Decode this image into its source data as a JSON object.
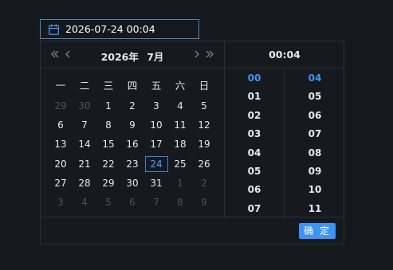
{
  "input": {
    "value": "2026-07-24 00:04",
    "icon": "calendar-icon"
  },
  "calendar": {
    "year_label": "2026年",
    "month_label": "7月",
    "weekdays": [
      "一",
      "二",
      "三",
      "四",
      "五",
      "六",
      "日"
    ],
    "days": [
      {
        "label": "29",
        "muted": true
      },
      {
        "label": "30",
        "muted": true
      },
      {
        "label": "1"
      },
      {
        "label": "2"
      },
      {
        "label": "3"
      },
      {
        "label": "4"
      },
      {
        "label": "5"
      },
      {
        "label": "6"
      },
      {
        "label": "7"
      },
      {
        "label": "8"
      },
      {
        "label": "9"
      },
      {
        "label": "10"
      },
      {
        "label": "11"
      },
      {
        "label": "12"
      },
      {
        "label": "13"
      },
      {
        "label": "14"
      },
      {
        "label": "15"
      },
      {
        "label": "16"
      },
      {
        "label": "17"
      },
      {
        "label": "18"
      },
      {
        "label": "19"
      },
      {
        "label": "20"
      },
      {
        "label": "21"
      },
      {
        "label": "22"
      },
      {
        "label": "23"
      },
      {
        "label": "24",
        "selected": true
      },
      {
        "label": "25"
      },
      {
        "label": "26"
      },
      {
        "label": "27"
      },
      {
        "label": "28"
      },
      {
        "label": "29"
      },
      {
        "label": "30"
      },
      {
        "label": "31"
      },
      {
        "label": "1",
        "muted": true
      },
      {
        "label": "2",
        "muted": true
      },
      {
        "label": "3",
        "muted": true
      },
      {
        "label": "4",
        "muted": true
      },
      {
        "label": "5",
        "muted": true
      },
      {
        "label": "6",
        "muted": true
      },
      {
        "label": "7",
        "muted": true
      },
      {
        "label": "8",
        "muted": true
      },
      {
        "label": "9",
        "muted": true
      }
    ]
  },
  "time": {
    "header": "00:04",
    "hours": [
      "00",
      "01",
      "02",
      "03",
      "04",
      "05",
      "06",
      "07"
    ],
    "minutes": [
      "04",
      "05",
      "06",
      "07",
      "08",
      "09",
      "10",
      "11"
    ],
    "selected_hour": "00",
    "selected_minute": "04"
  },
  "footer": {
    "confirm_label": "确 定"
  },
  "colors": {
    "accent": "#3f93f5",
    "background": "#15181d",
    "border": "#2b3038",
    "muted_text": "#4e545d"
  }
}
